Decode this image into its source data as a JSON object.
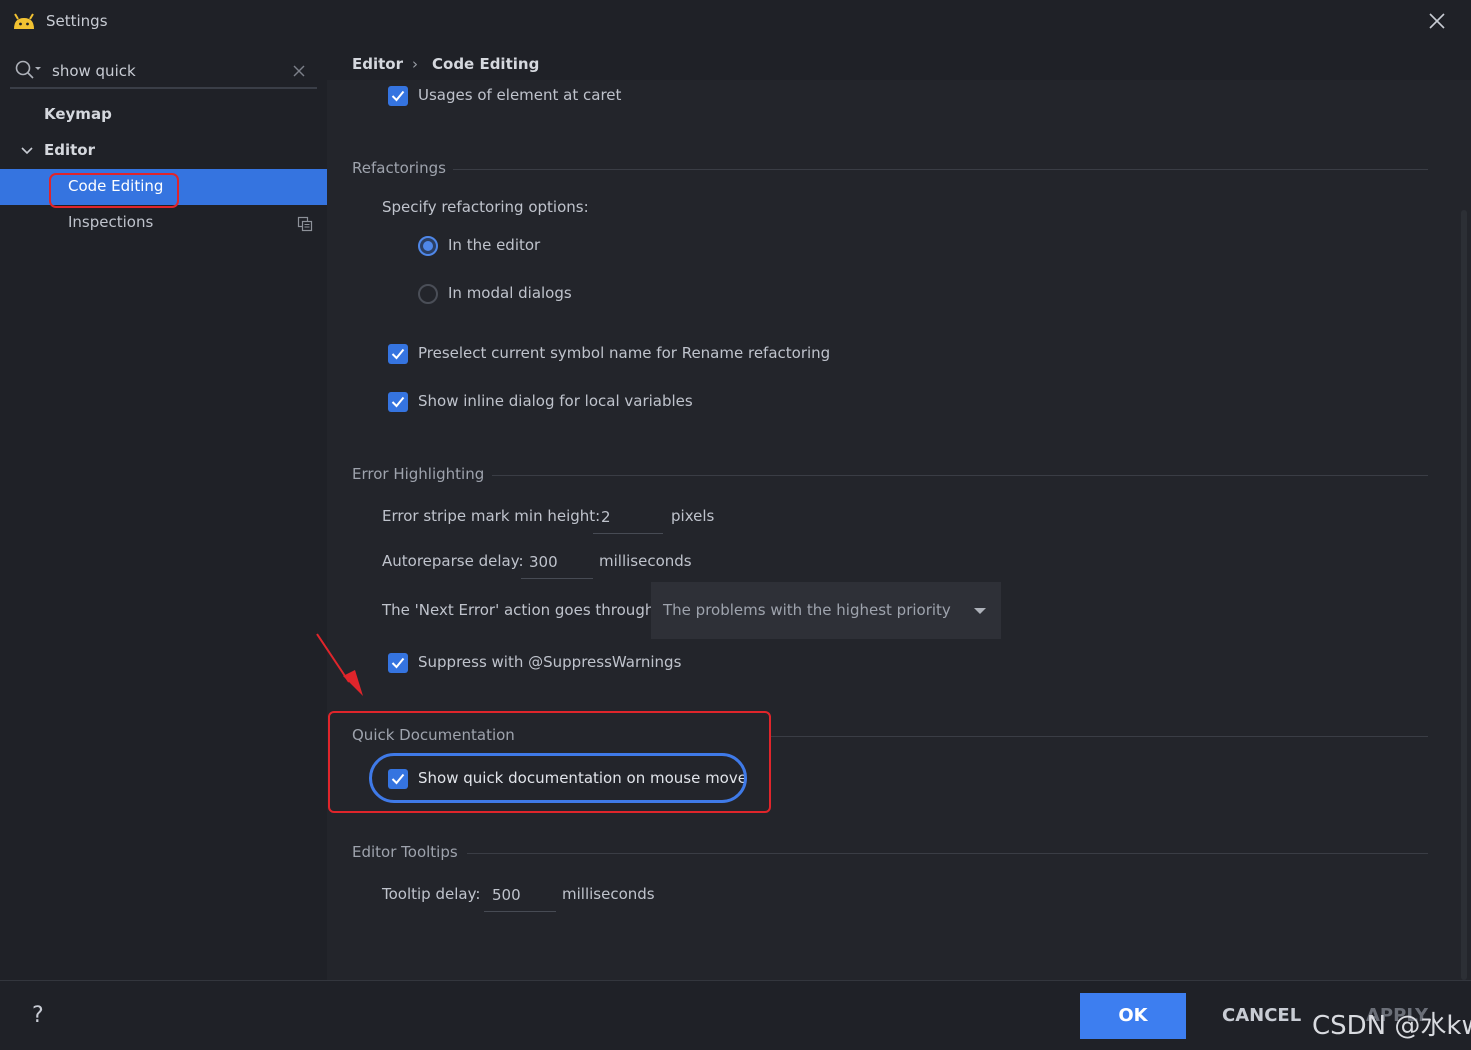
{
  "window": {
    "title": "Settings"
  },
  "search": {
    "value": "show quick"
  },
  "sidebar": {
    "items": [
      {
        "label": "Keymap"
      },
      {
        "label": "Editor"
      },
      {
        "label": "Code Editing"
      },
      {
        "label": "Inspections"
      }
    ]
  },
  "breadcrumb": {
    "parent": "Editor",
    "separator": "›",
    "current": "Code Editing"
  },
  "content": {
    "usages_label": "Usages of element at caret",
    "refactorings": {
      "title": "Refactorings",
      "specify_label": "Specify refactoring options:",
      "radio_editor": "In the editor",
      "radio_modal": "In modal dialogs",
      "preselect_label": "Preselect current symbol name for Rename refactoring",
      "inline_dialog_label": "Show inline dialog for local variables"
    },
    "error_highlighting": {
      "title": "Error Highlighting",
      "stripe_label": "Error stripe mark min height:",
      "stripe_value": "2",
      "stripe_unit": "pixels",
      "autoreparse_label": "Autoreparse delay:",
      "autoreparse_value": "300",
      "autoreparse_unit": "milliseconds",
      "next_error_label": "The 'Next Error' action goes through:",
      "next_error_value": "The problems with the highest priority",
      "suppress_label": "Suppress with @SuppressWarnings"
    },
    "quick_documentation": {
      "title": "Quick Documentation",
      "show_label": "Show quick documentation on mouse move"
    },
    "editor_tooltips": {
      "title": "Editor Tooltips",
      "delay_label": "Tooltip delay:",
      "delay_value": "500",
      "delay_unit": "milliseconds"
    }
  },
  "footer": {
    "help": "?",
    "ok": "OK",
    "cancel": "CANCEL",
    "apply": "APPLY"
  },
  "watermark": "CSDN @水kw",
  "colors": {
    "accent": "#3574e0",
    "annotation_red": "#e0252b",
    "background": "#23252b"
  }
}
